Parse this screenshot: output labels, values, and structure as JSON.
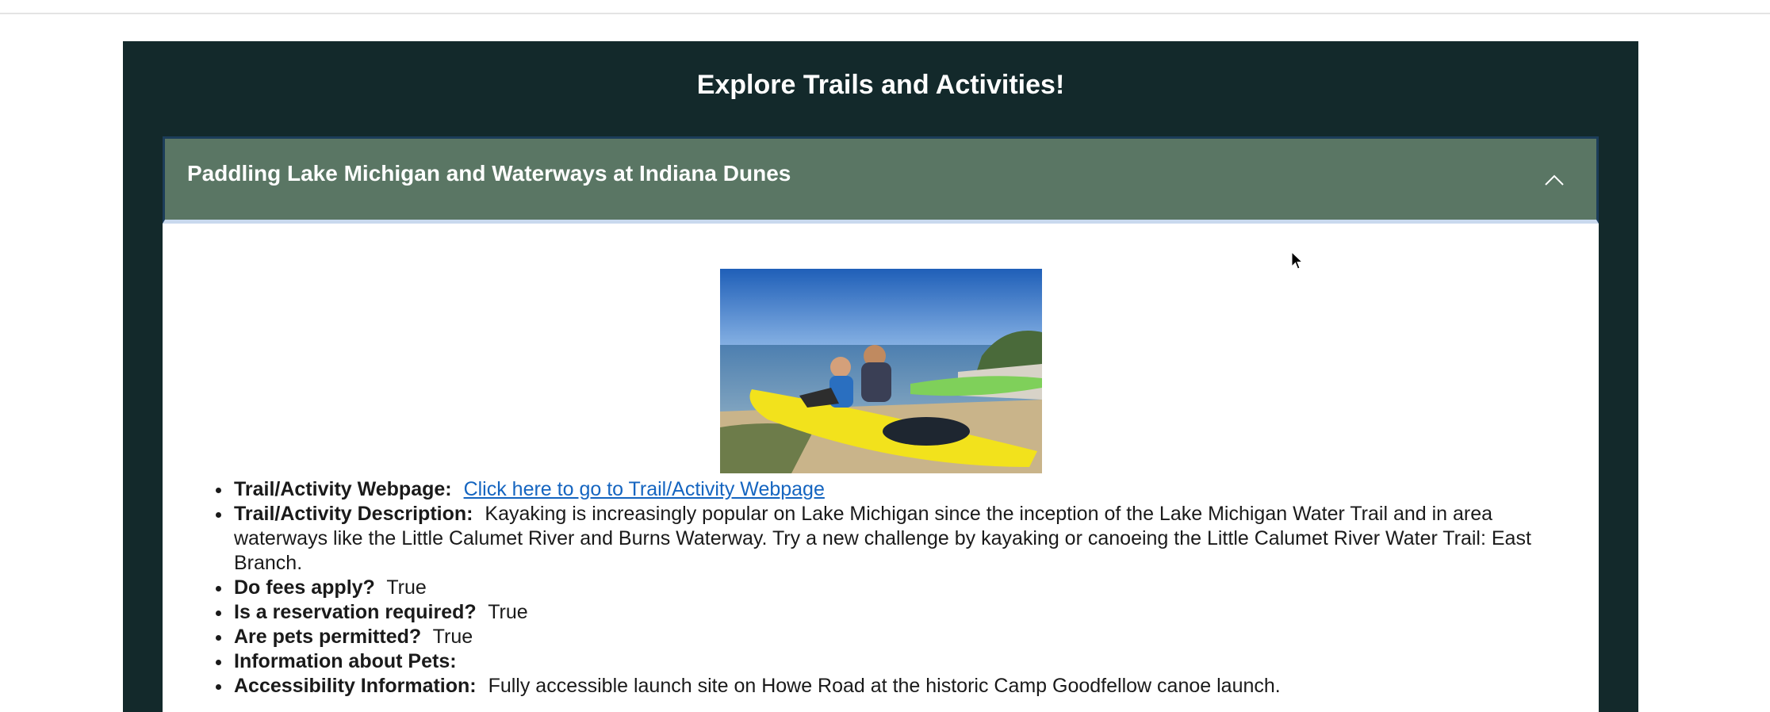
{
  "page": {
    "heading": "Explore Trails and Activities!"
  },
  "accordion": {
    "title": "Paddling Lake Michigan and Waterways at Indiana Dunes",
    "expanded": true,
    "chevron_icon": "chevron-up-icon"
  },
  "details": {
    "webpage_label": "Trail/Activity Webpage:",
    "webpage_link_text": "Click here to go to Trail/Activity Webpage",
    "description_label": "Trail/Activity Description:",
    "description_value": "Kayaking is increasingly popular on Lake Michigan since the inception of the Lake Michigan Water Trail and in area waterways like the Little Calumet River and Burns Waterway. Try a new challenge by kayaking or canoeing the Little Calumet River Water Trail: East Branch.",
    "fees_label": "Do fees apply?",
    "fees_value": "True",
    "reservation_label": "Is a reservation required?",
    "reservation_value": "True",
    "pets_label": "Are pets permitted?",
    "pets_value": "True",
    "pets_info_label": "Information about Pets:",
    "pets_info_value": "",
    "accessibility_label": "Accessibility Information:",
    "accessibility_value": "Fully accessible launch site on Howe Road at the historic Camp Goodfellow canoe launch."
  },
  "colors": {
    "panel_bg": "#13292b",
    "accordion_header_bg": "#5a7664",
    "link": "#1565c0"
  }
}
